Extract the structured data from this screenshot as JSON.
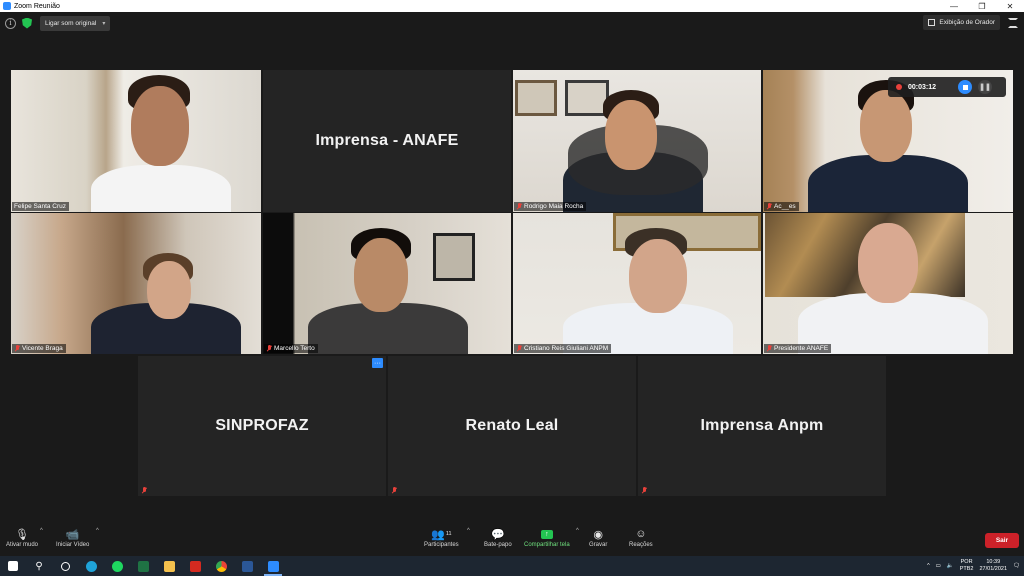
{
  "window": {
    "title": "Zoom Reunião"
  },
  "topbar": {
    "original_sound": "Ligar som original",
    "speaker_view": "Exibição de Orador"
  },
  "recording": {
    "time": "00:03:12"
  },
  "participants": [
    {
      "name": "Felipe Santa Cruz"
    },
    {
      "name": "Imprensa - ANAFE"
    },
    {
      "name": "Rodrigo Maia Rocha"
    },
    {
      "name": "Ac__es"
    },
    {
      "name": "Vicente Braga"
    },
    {
      "name": "Marcello Terto"
    },
    {
      "name": "Cristiano Reis Giuliani ANPM"
    },
    {
      "name": "Presidente ANAFE"
    },
    {
      "name": "SINPROFAZ"
    },
    {
      "name": "Renato Leal"
    },
    {
      "name": "Imprensa Anpm"
    }
  ],
  "toolbar": {
    "mute": "Ativar mudo",
    "video": "Iniciar Vídeo",
    "participants": "Participantes",
    "participants_count": "11",
    "chat": "Bate-papo",
    "share": "Compartilhar tela",
    "record": "Gravar",
    "reactions": "Reações",
    "leave": "Sair"
  },
  "taskbar": {
    "lang_1": "POR",
    "lang_2": "PTB2",
    "time": "10:39",
    "date": "27/01/2021"
  },
  "colors": {
    "accent": "#2d8cff",
    "active_speaker": "#cfe66b",
    "leave": "#cc2129",
    "record": "#e8413b"
  }
}
